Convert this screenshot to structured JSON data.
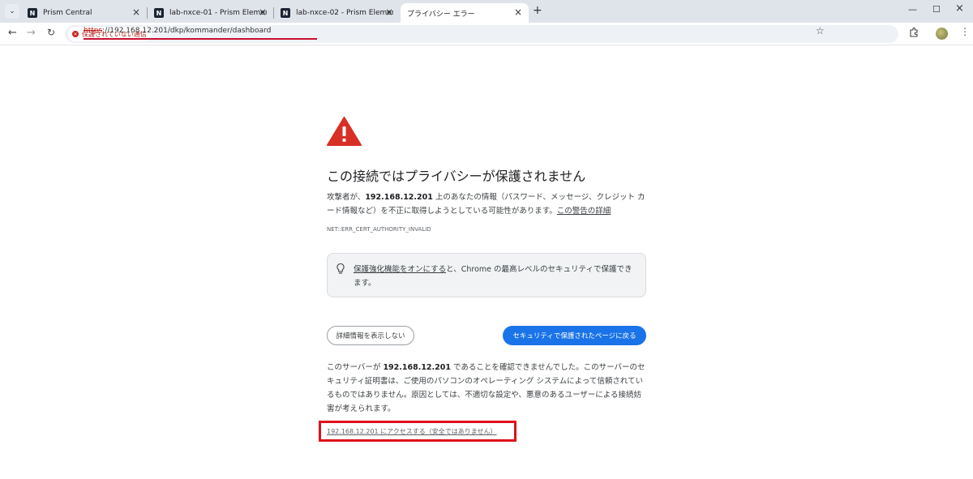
{
  "tabs": [
    {
      "title": "Prism Central",
      "favicon_letter": "N",
      "active": false
    },
    {
      "title": "lab-nxce-01 - Prism Element",
      "favicon_letter": "N",
      "active": false
    },
    {
      "title": "lab-nxce-02 - Prism Element",
      "favicon_letter": "N",
      "active": false
    },
    {
      "title": "プライバシー エラー",
      "favicon_letter": "",
      "active": true
    }
  ],
  "toolbar": {
    "security_chip": "保護されていない通信",
    "url_scheme": "https",
    "url_rest": "://192.168.12.201/dkp/kommander/dashboard"
  },
  "icons": {
    "back": "arrow-left-icon",
    "forward": "arrow-right-icon",
    "reload": "reload-icon",
    "star": "star-icon",
    "extensions": "puzzle-icon",
    "menu": "kebab-menu-icon"
  },
  "interstitial": {
    "heading": "この接続ではプライバシーが保護されません",
    "para1_prefix": "攻撃者が、",
    "para1_host": "192.168.12.201",
    "para1_suffix": " 上のあなたの情報（パスワード、メッセージ、クレジット カード情報など）を不正に取得しようとしている可能性があります。",
    "para1_link": "この警告の詳細",
    "error_code": "NET::ERR_CERT_AUTHORITY_INVALID",
    "info_link": "保護強化機能をオンにする",
    "info_text": "と、Chrome の最高レベルのセキュリティで保護できます。",
    "details_button": "詳細情報を表示しない",
    "back_button": "セキュリティで保護されたページに戻る",
    "para2_prefix": "このサーバーが ",
    "para2_host": "192.168.12.201",
    "para2_suffix": " であることを確認できませんでした。このサーバーのセキュリティ証明書は、ご使用のパソコンのオペレーティング システムによって信頼されているものではありません。原因としては、不適切な設定や、悪意のあるユーザーによる接続妨害が考えられます。",
    "proceed_link": "192.168.12.201 にアクセスする（安全ではありません）"
  },
  "colors": {
    "warning_red": "#d93025",
    "primary_blue": "#1a73e8",
    "highlight_red": "#e0101c"
  }
}
